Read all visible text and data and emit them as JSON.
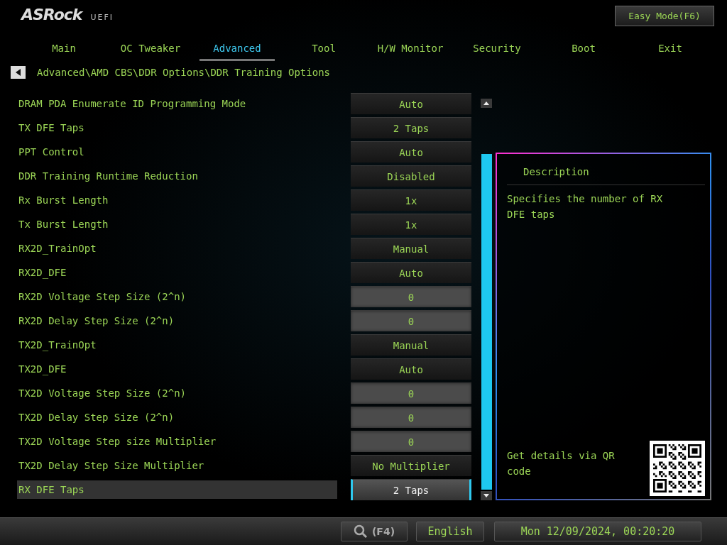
{
  "header": {
    "logo": "ASRock",
    "logo_suffix": "UEFI",
    "easy_mode_button": "Easy Mode(F6)"
  },
  "tabs": [
    {
      "label": "Main",
      "selected": false
    },
    {
      "label": "OC Tweaker",
      "selected": false
    },
    {
      "label": "Advanced",
      "selected": true
    },
    {
      "label": "Tool",
      "selected": false
    },
    {
      "label": "H/W Monitor",
      "selected": false
    },
    {
      "label": "Security",
      "selected": false
    },
    {
      "label": "Boot",
      "selected": false
    },
    {
      "label": "Exit",
      "selected": false
    }
  ],
  "breadcrumb": "Advanced\\AMD CBS\\DDR Options\\DDR Training Options",
  "settings": [
    {
      "label": "DRAM PDA Enumerate ID Programming Mode",
      "value": "Auto",
      "kind": "option",
      "selected": false
    },
    {
      "label": "TX DFE Taps",
      "value": "2 Taps",
      "kind": "option",
      "selected": false
    },
    {
      "label": "PPT Control",
      "value": "Auto",
      "kind": "option",
      "selected": false
    },
    {
      "label": "DDR Training Runtime Reduction",
      "value": "Disabled",
      "kind": "option",
      "selected": false
    },
    {
      "label": "Rx Burst Length",
      "value": "1x",
      "kind": "option",
      "selected": false
    },
    {
      "label": "Tx Burst Length",
      "value": "1x",
      "kind": "option",
      "selected": false
    },
    {
      "label": "RX2D_TrainOpt",
      "value": "Manual",
      "kind": "option",
      "selected": false
    },
    {
      "label": "RX2D_DFE",
      "value": "Auto",
      "kind": "option",
      "selected": false
    },
    {
      "label": "RX2D Voltage Step Size (2^n)",
      "value": "0",
      "kind": "number",
      "selected": false
    },
    {
      "label": "RX2D Delay Step Size (2^n)",
      "value": "0",
      "kind": "number",
      "selected": false
    },
    {
      "label": "TX2D_TrainOpt",
      "value": "Manual",
      "kind": "option",
      "selected": false
    },
    {
      "label": "TX2D_DFE",
      "value": "Auto",
      "kind": "option",
      "selected": false
    },
    {
      "label": "TX2D Voltage Step Size (2^n)",
      "value": "0",
      "kind": "number",
      "selected": false
    },
    {
      "label": "TX2D Delay Step Size (2^n)",
      "value": "0",
      "kind": "number",
      "selected": false
    },
    {
      "label": "TX2D Voltage Step size Multiplier",
      "value": "0",
      "kind": "number",
      "selected": false
    },
    {
      "label": "TX2D Delay Step Size Multiplier",
      "value": "No Multiplier",
      "kind": "option",
      "selected": false
    },
    {
      "label": "RX DFE Taps",
      "value": "2 Taps",
      "kind": "option",
      "selected": true
    }
  ],
  "description": {
    "title": "Description",
    "text": "Specifies the number of RX DFE taps",
    "qr_caption": "Get details via QR code"
  },
  "footer": {
    "search_key": "(F4)",
    "language": "English",
    "datetime": "Mon 12/09/2024, 00:20:20"
  }
}
